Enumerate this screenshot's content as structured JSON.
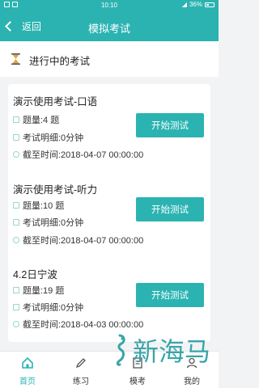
{
  "status_bar": {
    "time": "10:10",
    "battery": "36%"
  },
  "header": {
    "back_label": "返回",
    "title": "模拟考试"
  },
  "section": {
    "title": "进行中的考试"
  },
  "labels": {
    "start_button": "开始测试"
  },
  "exams": [
    {
      "title": "演示使用考试-口语",
      "questions": "题量:4 题",
      "detail": "考试明细:0分钟",
      "deadline": "截至时间:2018-04-07 00:00:00"
    },
    {
      "title": "演示使用考试-听力",
      "questions": "题量:10 题",
      "detail": "考试明细:0分钟",
      "deadline": "截至时间:2018-04-07 00:00:00"
    },
    {
      "title": "4.2日宁波",
      "questions": "题量:19 题",
      "detail": "考试明细:0分钟",
      "deadline": "截至时间:2018-04-03 00:00:00"
    }
  ],
  "tabbar": {
    "items": [
      {
        "label": "首页",
        "icon": "home-icon"
      },
      {
        "label": "练习",
        "icon": "pencil-icon"
      },
      {
        "label": "模考",
        "icon": "exam-icon"
      },
      {
        "label": "我的",
        "icon": "user-icon"
      }
    ]
  },
  "watermark": {
    "text": "新海马"
  },
  "colors": {
    "accent": "#2bb3b1"
  }
}
